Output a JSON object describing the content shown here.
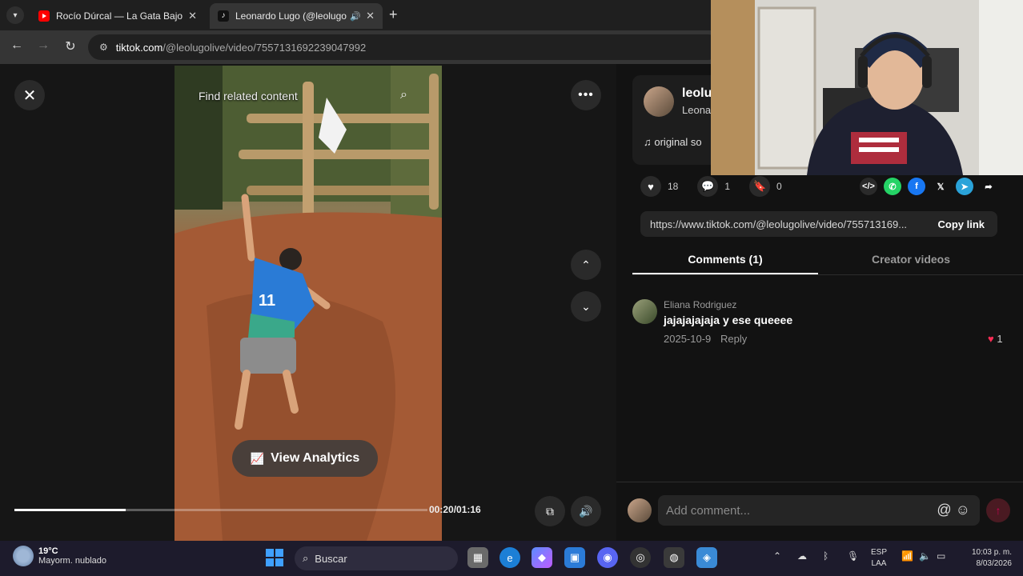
{
  "browser": {
    "tabs": [
      {
        "title": "Rocío Dúrcal — La Gata Bajo La",
        "favicon": "youtube-icon",
        "active": false
      },
      {
        "title": "Leonardo Lugo (@leolugoli",
        "favicon": "tiktok-icon",
        "active": true,
        "audio": true
      }
    ],
    "url_host": "tiktok.com",
    "url_path": "/@leolugolive/video/7557131692239047992"
  },
  "video": {
    "search_placeholder": "Find related content",
    "view_analytics_label": "View Analytics",
    "progress": 0.27,
    "time_display": "00:20/01:16"
  },
  "post": {
    "username": "leolu",
    "nickname": "Leona",
    "music": "original so",
    "likes": "18",
    "comments": "1",
    "saves": "0",
    "link_url": "https://www.tiktok.com/@leolugolive/video/755713169...",
    "copy_link_label": "Copy link"
  },
  "panel_tabs": [
    {
      "label": "Comments (1)",
      "active": true
    },
    {
      "label": "Creator videos",
      "active": false
    }
  ],
  "comments": [
    {
      "author": "Eliana Rodriguez",
      "text": "jajajajajaja y ese queeee",
      "date": "2025-10-9",
      "reply_label": "Reply",
      "likes": "1"
    }
  ],
  "comment_input": {
    "placeholder": "Add comment..."
  },
  "taskbar": {
    "weather_temp": "19°C",
    "weather_desc": "Mayorm. nublado",
    "search_label": "Buscar",
    "lang_line1": "ESP",
    "lang_line2": "LAA",
    "time": "10:03 p. m.",
    "date": "8/03/2026"
  },
  "colors": {
    "accent_pink": "#fe2c55",
    "whatsapp": "#25d366",
    "facebook": "#1877f2",
    "telegram": "#2aa3d9"
  }
}
